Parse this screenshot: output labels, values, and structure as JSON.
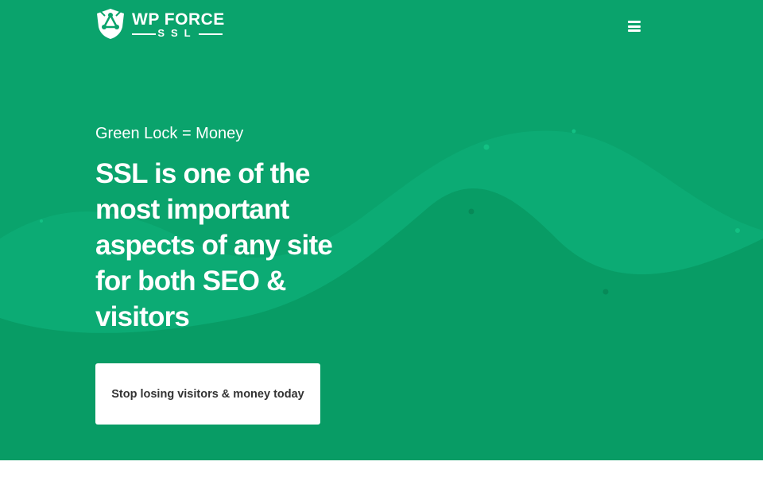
{
  "brand": {
    "name_line1": "WP FORCE",
    "name_line2": "SSL",
    "logo_icon": "shield-lock-icon"
  },
  "header": {
    "menu_icon": "hamburger-menu-icon"
  },
  "hero": {
    "tagline": "Green Lock = Money",
    "headline": "SSL is one of the most important aspects of any site for both SEO & visitors",
    "cta_label": "Stop losing visitors & money today"
  },
  "colors": {
    "hero_background": "#0aa36c",
    "wave_light": "#0fb37b",
    "wave_dark": "#07965f",
    "text": "#ffffff",
    "button_bg": "#ffffff",
    "button_text": "#333333"
  }
}
